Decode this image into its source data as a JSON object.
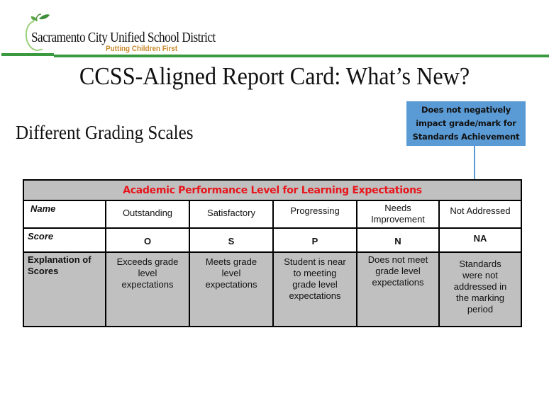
{
  "logo": {
    "name": "Sacramento City Unified School District",
    "tagline": "Putting Children First"
  },
  "page_title": "CCSS-Aligned Report Card: What’s New?",
  "section_title": "Different Grading Scales",
  "callout": {
    "lines": [
      "Does not negatively",
      "impact grade/mark for",
      "Standards Achievement"
    ],
    "color": "#5b9bd5"
  },
  "table": {
    "header": "Academic Performance Level for Learning Expectations",
    "header_color": "#e8151b",
    "row_labels": {
      "name": "Name",
      "score": "Score",
      "explanation": [
        "Explanation of",
        "Scores"
      ]
    },
    "columns": [
      {
        "name": [
          "Outstanding"
        ],
        "score": "O",
        "explanation": [
          "Exceeds grade",
          "level",
          "expectations"
        ]
      },
      {
        "name": [
          "Satisfactory"
        ],
        "score": "S",
        "explanation": [
          "Meets grade",
          "level",
          "expectations"
        ]
      },
      {
        "name": [
          "Progressing"
        ],
        "score": "P",
        "explanation": [
          "Student is near",
          "to meeting",
          "grade level",
          "expectations"
        ]
      },
      {
        "name": [
          "Needs",
          "Improvement"
        ],
        "score": "N",
        "explanation": [
          "Does not meet",
          "grade level",
          "expectations"
        ]
      },
      {
        "name": [
          "Not Addressed"
        ],
        "score": "NA",
        "explanation": [
          "Standards",
          "were not",
          "addressed in",
          "the marking",
          "period"
        ]
      }
    ]
  }
}
